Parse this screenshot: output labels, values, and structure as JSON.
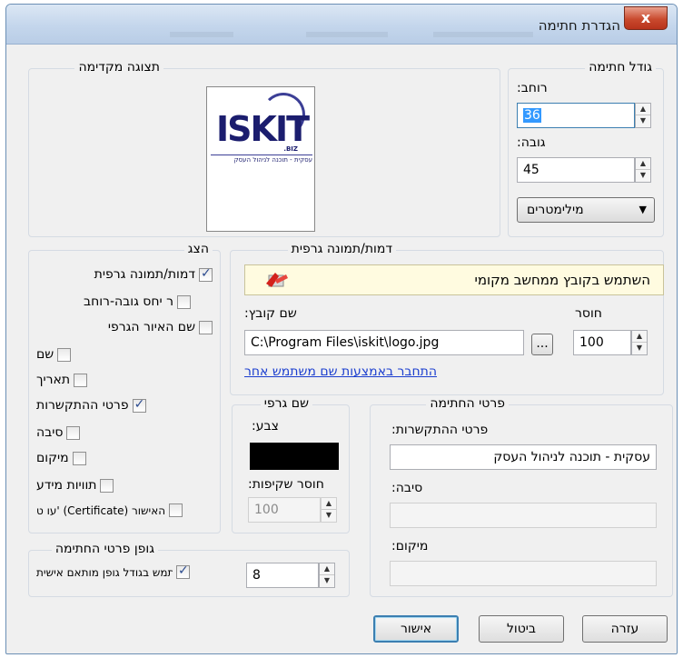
{
  "window": {
    "title": "הגדרת חתימה",
    "close_label": "x"
  },
  "preview": {
    "legend": "תצוגה מקדימה",
    "logo": {
      "main": "ISKIT",
      "suffix": ".BIZ",
      "tagline": "עסקית - תוכנה לניהול העסק"
    }
  },
  "signature_size": {
    "legend": "גודל חתימה",
    "width_label": "רוחב:",
    "width_value": "36",
    "height_label": "גובה:",
    "height_value": "45",
    "units_value": "מילימטרים"
  },
  "show": {
    "legend": "הצג",
    "items": [
      {
        "label": "דמות/תמונה גרפית",
        "checked": true
      },
      {
        "label": "ר יחס גובה-רוחב",
        "checked": false
      },
      {
        "label": "שם האיור הגרפי",
        "checked": false
      },
      {
        "label": "שם",
        "checked": false
      },
      {
        "label": "תאריך",
        "checked": false
      },
      {
        "label": "פרטי ההתקשרות",
        "checked": true
      },
      {
        "label": "סיבה",
        "checked": false
      },
      {
        "label": "מיקום",
        "checked": false
      },
      {
        "label": "תוויות מידע",
        "checked": false
      },
      {
        "label": "עו ט' (Certificate) האישור",
        "checked": false
      }
    ]
  },
  "graphic": {
    "legend": "דמות/תמונה גרפית",
    "use_local_file": "השתמש בקובץ ממחשב מקומי",
    "filename_label": "שם קובץ:",
    "filename_value": "C:\\Program Files\\iskit\\logo.jpg",
    "browse_label": "...",
    "opacity_label": "חוסר",
    "opacity_value": "100",
    "connect_link": "התחבר באמצעות שם משתמש אחר"
  },
  "graphic_name": {
    "legend": "שם גרפי",
    "color_label": "צבע:",
    "color_value": "#000000",
    "transparency_label": "חוסר שקיפות:",
    "transparency_value": "100"
  },
  "signature_details": {
    "legend": "פרטי החתימה",
    "contact_label": "פרטי ההתקשרות:",
    "contact_value": "עסקית - תוכנה לניהול העסק",
    "reason_label": "סיבה:",
    "reason_value": "",
    "location_label": "מיקום:",
    "location_value": ""
  },
  "font": {
    "legend": "גופן פרטי החתימה",
    "use_font_label": "השתמש בגודל גופן מותאם אישית",
    "use_font_checked": true,
    "font_size_value": "8"
  },
  "buttons": {
    "ok": "אישור",
    "cancel": "ביטול",
    "help": "עזרה"
  }
}
